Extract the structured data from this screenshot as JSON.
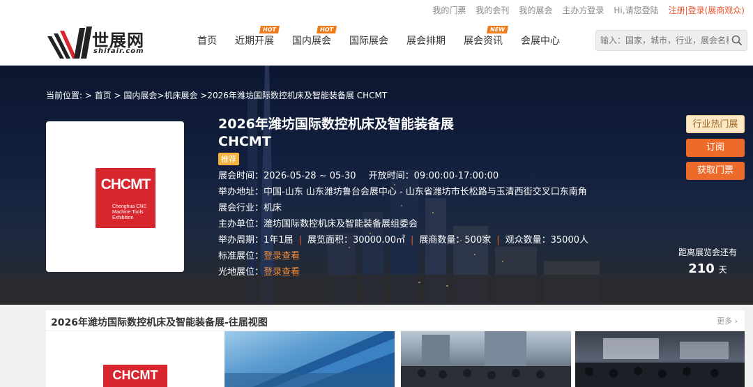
{
  "topbar": {
    "links": [
      "我的门票",
      "我的会刊",
      "我的展会",
      "主办方登录",
      "Hi,请您登陆"
    ],
    "register": "注册|登录(展商观众)"
  },
  "logo": {
    "brand": "世展网",
    "sub": "shifair.com"
  },
  "nav": [
    {
      "label": "首页",
      "tag": ""
    },
    {
      "label": "近期开展",
      "tag": "HOT"
    },
    {
      "label": "国内展会",
      "tag": "HOT"
    },
    {
      "label": "国际展会",
      "tag": ""
    },
    {
      "label": "展会排期",
      "tag": ""
    },
    {
      "label": "展会资讯",
      "tag": "NEW"
    },
    {
      "label": "会展中心",
      "tag": ""
    }
  ],
  "search": {
    "placeholder": "输入：国家，城市，行业，展会名称"
  },
  "breadcrumb": "当前位置: > 首页 > 国内展会>机床展会 >2026年潍坊国际数控机床及智能装备展 CHCMT",
  "poster": {
    "main": "CHCMT",
    "sub1": "Chenghua CNC",
    "sub2": "Machine Tools",
    "sub3": "Exhibition"
  },
  "expo": {
    "title1": "2026年潍坊国际数控机床及智能装备展",
    "title2": "CHCMT",
    "badge": "推荐",
    "date_label": "展会时间：",
    "date": "2026-05-28 ~ 05-30",
    "open_label": "开放时间：",
    "open": "09:00:00-17:00:00",
    "address_label": "举办地址：",
    "address": "中国-山东 山东潍坊鲁台会展中心 - 山东省潍坊市长松路与玉清西街交叉口东南角",
    "industry_label": "展会行业：",
    "industry": "机床",
    "organizer_label": "主办单位：",
    "organizer": "潍坊国际数控机床及智能装备展组委会",
    "cycle_label": "举办周期：",
    "cycle": "1年1届",
    "area_label": "展览面积：",
    "area": "30000.00㎡",
    "exhibitors_label": "展商数量：",
    "exhibitors": "500家",
    "visitors_label": "观众数量：",
    "visitors": "35000人",
    "std_booth_label": "标准展位：",
    "std_booth": "登录查看",
    "raw_booth_label": "光地展位：",
    "raw_booth": "登录查看"
  },
  "buttons": {
    "hot": "行业热门展",
    "subscribe": "订阅",
    "tickets": "获取门票"
  },
  "countdown": {
    "label": "距离展览会还有",
    "days": "210",
    "unit": "天"
  },
  "past": {
    "title": "2026年潍坊国际数控机床及智能装备展-往届视图",
    "more": "更多",
    "thumb1_logo": "CHCMT"
  }
}
